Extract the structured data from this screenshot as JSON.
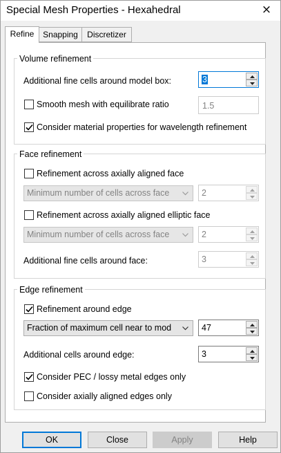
{
  "window": {
    "title": "Special Mesh Properties - Hexahedral",
    "close_icon": "×"
  },
  "tabs": [
    {
      "label": "Refine",
      "active": true
    },
    {
      "label": "Snapping",
      "active": false
    },
    {
      "label": "Discretizer",
      "active": false
    }
  ],
  "volume": {
    "title": "Volume refinement",
    "fine_cells_label": "Additional fine cells around model box:",
    "fine_cells_value": "3",
    "smooth_label": "Smooth mesh with equilibrate ratio",
    "smooth_checked": false,
    "smooth_value": "1.5",
    "material_label": "Consider material properties for wavelength refinement",
    "material_checked": true
  },
  "face": {
    "title": "Face refinement",
    "axial_label": "Refinement across axially aligned face",
    "axial_checked": false,
    "axial_combo": "Minimum number of cells across face",
    "axial_value": "2",
    "elliptic_label": "Refinement across axially aligned elliptic face",
    "elliptic_checked": false,
    "elliptic_combo": "Minimum number of cells across face",
    "elliptic_value": "2",
    "fine_cells_label": "Additional fine cells around face:",
    "fine_cells_value": "3"
  },
  "edge": {
    "title": "Edge refinement",
    "around_label": "Refinement around edge",
    "around_checked": true,
    "combo": "Fraction of maximum cell near to mod",
    "combo_value": "47",
    "cells_label": "Additional cells around edge:",
    "cells_value": "3",
    "pec_label": "Consider PEC / lossy metal edges only",
    "pec_checked": true,
    "axial_label": "Consider axially aligned edges only",
    "axial_checked": false
  },
  "buttons": {
    "ok": "OK",
    "close": "Close",
    "apply": "Apply",
    "help": "Help"
  }
}
